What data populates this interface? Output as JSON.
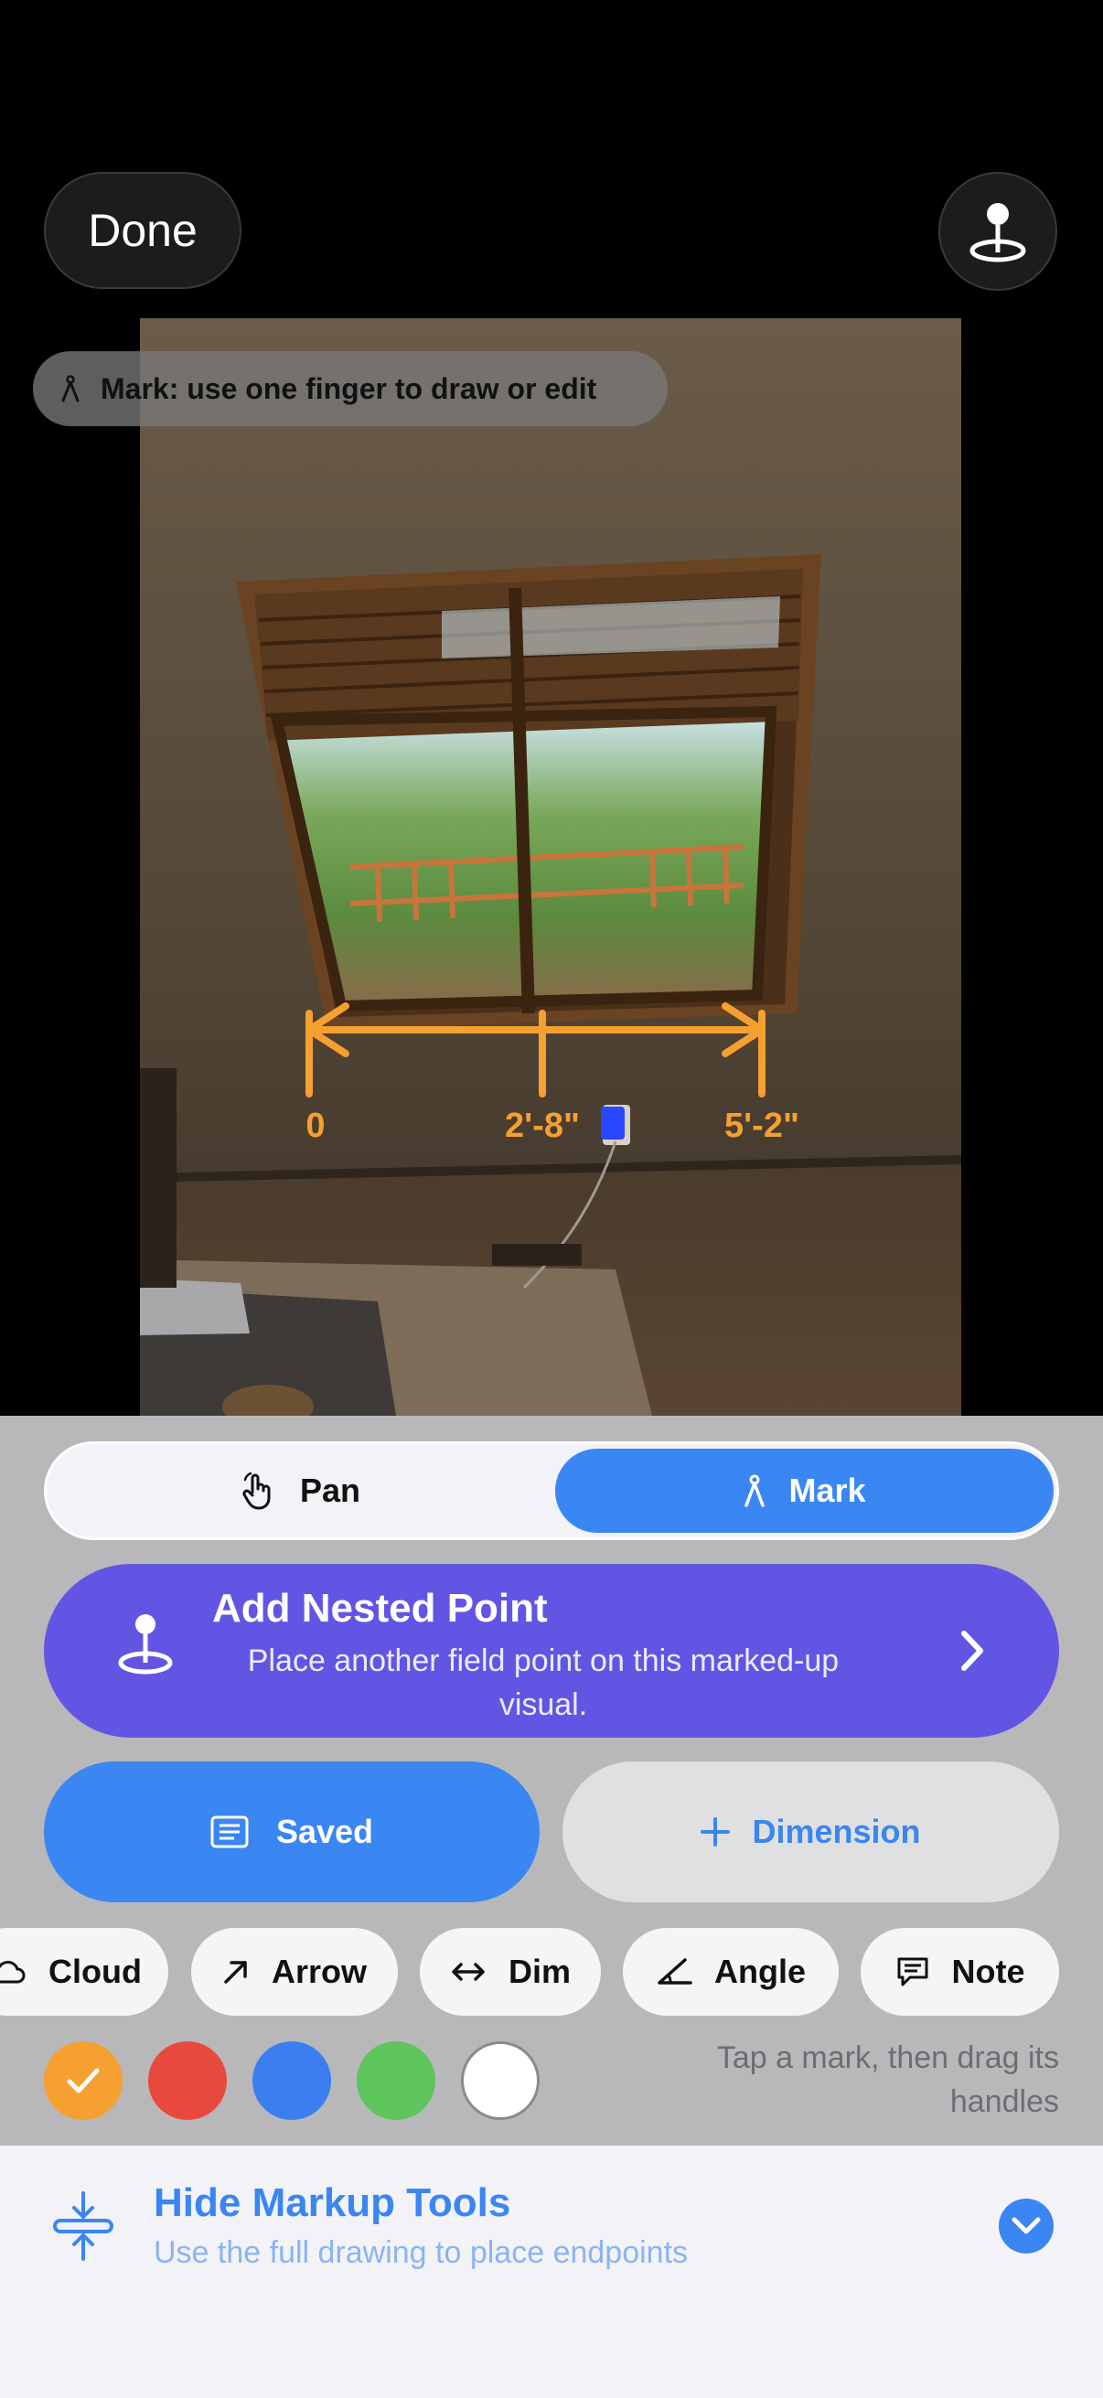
{
  "header": {
    "done_label": "Done",
    "pin_icon": "field-point-pin-icon"
  },
  "hint": {
    "icon": "compass-mark-icon",
    "text": "Mark: use one finger to draw or edit"
  },
  "dimension_overlay": {
    "color": "#f5a030",
    "labels": [
      "0",
      "2'-8\"",
      "5'-2\""
    ]
  },
  "mode_toggle": {
    "selected": "Mark",
    "pan_label": "Pan",
    "pan_icon": "hand-pointer-icon",
    "mark_label": "Mark",
    "mark_icon": "compass-mark-icon"
  },
  "nested_point": {
    "title": "Add Nested Point",
    "subtitle": "Place another field point on this marked-up visual.",
    "icon": "field-point-pin-icon",
    "chevron": "chevron-right-icon"
  },
  "actions": {
    "saved_label": "Saved",
    "saved_icon": "list-doc-icon",
    "dimension_label": "Dimension",
    "dimension_icon": "plus-icon"
  },
  "tools": [
    {
      "label": "Cloud",
      "icon": "cloud-icon"
    },
    {
      "label": "Arrow",
      "icon": "arrow-up-right-icon"
    },
    {
      "label": "Dim",
      "icon": "double-arrow-icon"
    },
    {
      "label": "Angle",
      "icon": "angle-icon"
    },
    {
      "label": "Note",
      "icon": "speech-bubble-icon"
    }
  ],
  "colors": {
    "selected": "#f5a030",
    "swatches": [
      "#f5a030",
      "#e9483d",
      "#3a7ef0",
      "#5ec45c",
      "#ffffff"
    ]
  },
  "tap_hint": "Tap a mark, then drag its handles",
  "bottom_sheet": {
    "title": "Hide Markup Tools",
    "subtitle": "Use the full drawing to place endpoints",
    "icon": "collapse-vertical-icon",
    "chevron": "chevron-down-icon"
  }
}
